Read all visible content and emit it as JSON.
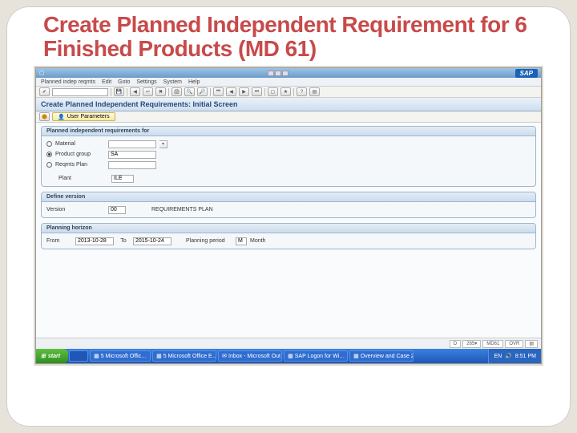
{
  "slide": {
    "title": "Create Planned Independent Requirement for 6 Finished Products (MD 61)"
  },
  "sap": {
    "logo": "SAP",
    "menu": [
      "Planned indep reqmts",
      "Edit",
      "Goto",
      "Settings",
      "System",
      "Help"
    ],
    "title": "Create Planned Independent Requirements: Initial Screen",
    "user_params_btn": "User Parameters",
    "panel1": {
      "title": "Planned independent requirements for",
      "opt_material": "Material",
      "opt_product_group": "Product group",
      "opt_reqplan": "Reqmts Plan",
      "product_group_val": "SA",
      "plant_label": "Plant",
      "plant_val": "ILE"
    },
    "panel2": {
      "title": "Define version",
      "version_label": "Version",
      "version_val": "00",
      "version_txt": "REQUIREMENTS PLAN"
    },
    "panel3": {
      "title": "Planning horizon",
      "from_label": "From",
      "from_val": "2013-10-28",
      "to_label": "To",
      "to_val": "2015-10-24",
      "period_label": "Planning period",
      "period_code": "M",
      "period_txt": "Month"
    },
    "status": {
      "d": "D",
      "sid": "265",
      "client": "MD61",
      "ovr": "OVR"
    }
  },
  "taskbar": {
    "start": "start",
    "tasks": [
      "5 Microsoft Offic…",
      "5 Microsoft Office E…",
      "Inbox - Microsoft Out…",
      "SAP Logon for Wi…",
      "Overview and Case 2…"
    ],
    "lang": "EN",
    "time": "8:51 PM"
  }
}
